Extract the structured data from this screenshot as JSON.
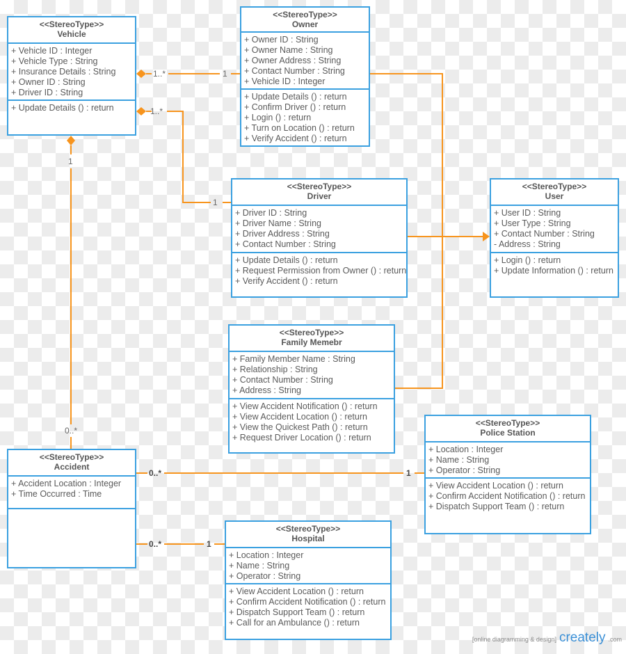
{
  "colors": {
    "border": "#3aa0e0",
    "connector": "#f7941d"
  },
  "classes": [
    {
      "id": "vehicle",
      "stereotype": "<<StereoType>>",
      "name": "Vehicle",
      "attributes": [
        "+ Vehicle ID : Integer",
        "+ Vehicle Type : String",
        "+ Insurance Details : String",
        "+ Owner ID : String",
        "+ Driver ID : String"
      ],
      "methods": [
        "+ Update Details () : return"
      ]
    },
    {
      "id": "owner",
      "stereotype": "<<StereoType>>",
      "name": "Owner",
      "attributes": [
        "+ Owner ID : String",
        "+ Owner Name : String",
        "+ Owner Address : String",
        "+ Contact Number : String",
        "+ Vehicle ID : Integer"
      ],
      "methods": [
        "+ Update Details () : return",
        "+ Confirm Driver () : return",
        "+ Login () : return",
        "+ Turn on Location () : return",
        "+ Verify Accident () : return"
      ]
    },
    {
      "id": "driver",
      "stereotype": "<<StereoType>>",
      "name": "Driver",
      "attributes": [
        "+ Driver ID : String",
        "+ Driver Name : String",
        "+ Driver Address : String",
        "+ Contact Number : String"
      ],
      "methods": [
        "+ Update Details () : return",
        "+ Request Permission from Owner () : return",
        "+ Verify Accident () : return"
      ]
    },
    {
      "id": "user",
      "stereotype": "<<StereoType>>",
      "name": "User",
      "attributes": [
        "+ User ID : String",
        "+ User Type : String",
        "+ Contact Number : String",
        "- Address : String"
      ],
      "methods": [
        "+ Login () : return",
        "+ Update Information () : return"
      ]
    },
    {
      "id": "family",
      "stereotype": "<<StereoType>>",
      "name": "Family Memebr",
      "attributes": [
        "+ Family Member Name : String",
        "+ Relationship : String",
        "+ Contact Number : String",
        "+ Address : String"
      ],
      "methods": [
        "+ View Accident Notification () : return",
        "+ View Accident Location () : return",
        "+ View the Quickest Path () : return",
        "+ Request Driver Location () : return"
      ]
    },
    {
      "id": "police",
      "stereotype": "<<StereoType>>",
      "name": "Police Station",
      "attributes": [
        "+ Location : Integer",
        "+ Name : String",
        "+ Operator : String"
      ],
      "methods": [
        "+ View Accident Location () : return",
        "+ Confirm Accident Notification () : return",
        "+ Dispatch Support Team () : return"
      ]
    },
    {
      "id": "accident",
      "stereotype": "<<StereoType>>",
      "name": "Accident",
      "attributes": [
        "+ Accident Location : Integer",
        "+ Time Occurred : Time"
      ],
      "methods": []
    },
    {
      "id": "hospital",
      "stereotype": "<<StereoType>>",
      "name": "Hospital",
      "attributes": [
        "+ Location : Integer",
        "+ Name : String",
        "+ Operator : String"
      ],
      "methods": [
        "+ View Accident Location () : return",
        "+ Confirm Accident Notification () : return",
        "+ Dispatch Support Team () : return",
        "+ Call for an Ambulance () : return"
      ]
    }
  ],
  "multiplicities": {
    "vehicle_owner_a": "1..*",
    "vehicle_owner_b": "1",
    "vehicle_driver_a": "1..*",
    "vehicle_driver_b": "1",
    "vehicle_accident_a": "1",
    "vehicle_accident_b": "0..*",
    "accident_police_a": "0..*",
    "accident_police_b": "1",
    "accident_hospital_a": "0..*",
    "accident_hospital_b": "1"
  },
  "branding": {
    "tagline": "[online diagramming & design]",
    "logo": "creately",
    "logo_suffix": ".com"
  }
}
